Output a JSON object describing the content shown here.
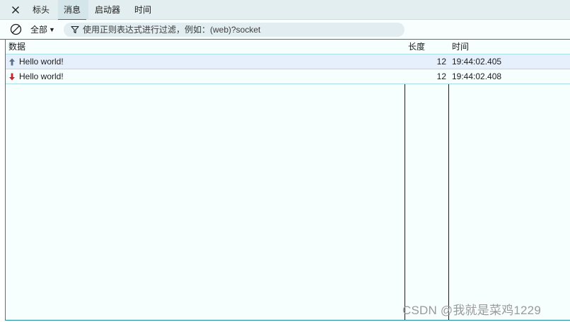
{
  "tabs": [
    {
      "label": "标头"
    },
    {
      "label": "消息"
    },
    {
      "label": "启动器"
    },
    {
      "label": "时间"
    }
  ],
  "active_tab_index": 1,
  "toolbar": {
    "filter_label": "全部",
    "search_placeholder": "使用正则表达式进行过滤，例如：(web)?socket",
    "search_value": ""
  },
  "table": {
    "headers": {
      "data": "数据",
      "length": "长度",
      "time": "时间"
    },
    "rows": [
      {
        "direction": "sent",
        "data": "Hello world!",
        "length": "12",
        "time": "19:44:02.405"
      },
      {
        "direction": "received",
        "data": "Hello world!",
        "length": "12",
        "time": "19:44:02.408"
      }
    ]
  },
  "colors": {
    "accent": "#0a84a8",
    "sent_arrow": "#5d6f86",
    "received_arrow": "#c8222a",
    "sent_row_bg": "#e6f0fc"
  },
  "watermark": "CSDN @我就是菜鸡1229"
}
